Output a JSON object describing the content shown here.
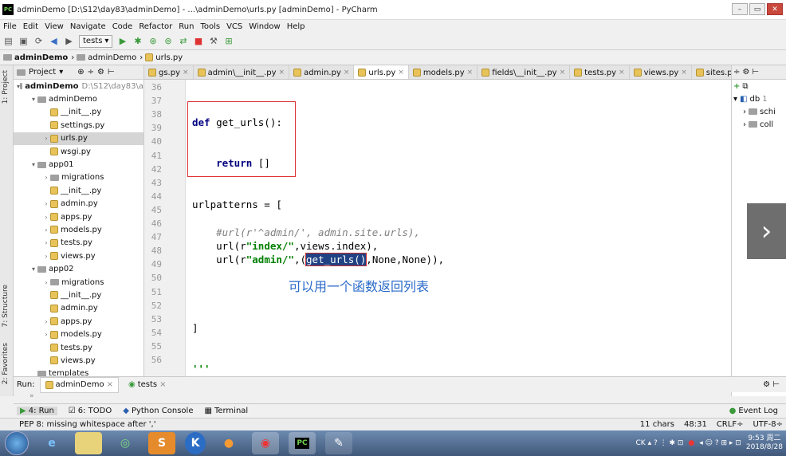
{
  "window": {
    "title": "adminDemo [D:\\S12\\day83\\adminDemo] - ...\\adminDemo\\urls.py [adminDemo] - PyCharm",
    "app_badge": "PC"
  },
  "menu": [
    "File",
    "Edit",
    "View",
    "Navigate",
    "Code",
    "Refactor",
    "Run",
    "Tools",
    "VCS",
    "Window",
    "Help"
  ],
  "toolbar": {
    "run_config": "tests"
  },
  "breadcrumbs": [
    "adminDemo",
    "adminDemo",
    "urls.py"
  ],
  "project_panel": {
    "label": "Project",
    "side_tab": "1: Project"
  },
  "tree": [
    {
      "name": "adminDemo",
      "hint": "D:\\S12\\day83\\a",
      "indent": 0,
      "arrow": "▾",
      "bold": true,
      "type": "folder"
    },
    {
      "name": "adminDemo",
      "indent": 1,
      "arrow": "▾",
      "type": "folder"
    },
    {
      "name": "__init__.py",
      "indent": 2,
      "arrow": "",
      "type": "py"
    },
    {
      "name": "settings.py",
      "indent": 2,
      "arrow": "",
      "type": "py"
    },
    {
      "name": "urls.py",
      "indent": 2,
      "arrow": "›",
      "type": "py",
      "selected": true
    },
    {
      "name": "wsgi.py",
      "indent": 2,
      "arrow": "",
      "type": "py"
    },
    {
      "name": "app01",
      "indent": 1,
      "arrow": "▾",
      "type": "folder"
    },
    {
      "name": "migrations",
      "indent": 2,
      "arrow": "›",
      "type": "folder"
    },
    {
      "name": "__init__.py",
      "indent": 2,
      "arrow": "",
      "type": "py"
    },
    {
      "name": "admin.py",
      "indent": 2,
      "arrow": "›",
      "type": "py"
    },
    {
      "name": "apps.py",
      "indent": 2,
      "arrow": "›",
      "type": "py"
    },
    {
      "name": "models.py",
      "indent": 2,
      "arrow": "›",
      "type": "py"
    },
    {
      "name": "tests.py",
      "indent": 2,
      "arrow": "›",
      "type": "py"
    },
    {
      "name": "views.py",
      "indent": 2,
      "arrow": "›",
      "type": "py"
    },
    {
      "name": "app02",
      "indent": 1,
      "arrow": "▾",
      "type": "folder"
    },
    {
      "name": "migrations",
      "indent": 2,
      "arrow": "›",
      "type": "folder"
    },
    {
      "name": "__init__.py",
      "indent": 2,
      "arrow": "",
      "type": "py"
    },
    {
      "name": "admin.py",
      "indent": 2,
      "arrow": "",
      "type": "py"
    },
    {
      "name": "apps.py",
      "indent": 2,
      "arrow": "›",
      "type": "py"
    },
    {
      "name": "models.py",
      "indent": 2,
      "arrow": "›",
      "type": "py"
    },
    {
      "name": "tests.py",
      "indent": 2,
      "arrow": "",
      "type": "py"
    },
    {
      "name": "views.py",
      "indent": 2,
      "arrow": "",
      "type": "py"
    },
    {
      "name": "templates",
      "indent": 1,
      "arrow": "",
      "type": "folder"
    }
  ],
  "tabs": [
    {
      "label": "gs.py",
      "active": false
    },
    {
      "label": "admin\\__init__.py",
      "active": false
    },
    {
      "label": "admin.py",
      "active": false
    },
    {
      "label": "urls.py",
      "active": true
    },
    {
      "label": "models.py",
      "active": false
    },
    {
      "label": "fields\\__init__.py",
      "active": false
    },
    {
      "label": "tests.py",
      "active": false
    },
    {
      "label": "views.py",
      "active": false
    },
    {
      "label": "sites.py",
      "active": false
    }
  ],
  "tab_overflow": "▾≡1",
  "line_numbers": [
    "36",
    "37",
    "38",
    "39",
    "40",
    "41",
    "42",
    "43",
    "44",
    "45",
    "46",
    "47",
    "48",
    "49",
    "50",
    "51",
    "52",
    "53",
    "54",
    "55",
    "56"
  ],
  "code": {
    "l38_kw": "def",
    "l38_rest": " get_urls():",
    "l41_kw": "return",
    "l41_rest": " []",
    "l44": "urlpatterns = [",
    "l46": "#url(r'^admin/', admin.site.urls),",
    "l47_a": "url(r",
    "l47_s": "\"index/\"",
    "l47_b": ",views.index),",
    "l48_a": "url(r",
    "l48_s": "\"admin/\"",
    "l48_b": ",(",
    "l48_hl": "get_urls()",
    "l48_c": ",None,None)),",
    "l53": "]",
    "l56": "'''"
  },
  "annotation": "可以用一个函数返回列表",
  "db_panel": {
    "root": "db",
    "root_badge": "1",
    "children": [
      "schi",
      "coll"
    ]
  },
  "run_panel": {
    "label": "Run:",
    "tabs": [
      "adminDemo",
      "tests"
    ]
  },
  "bottom_tabs": [
    "4: Run",
    "6: TODO",
    "Python Console",
    "Terminal"
  ],
  "event_log": "Event Log",
  "side_tabs": {
    "structure": "7: Structure",
    "favorites": "2: Favorites"
  },
  "status": {
    "message": "PEP 8: missing whitespace after ','",
    "chars": "11 chars",
    "position": "48:31",
    "line_sep": "CRLF÷",
    "encoding": "UTF-8÷"
  },
  "taskbar": {
    "time": "9:53 周二",
    "date": "2018/8/28"
  }
}
